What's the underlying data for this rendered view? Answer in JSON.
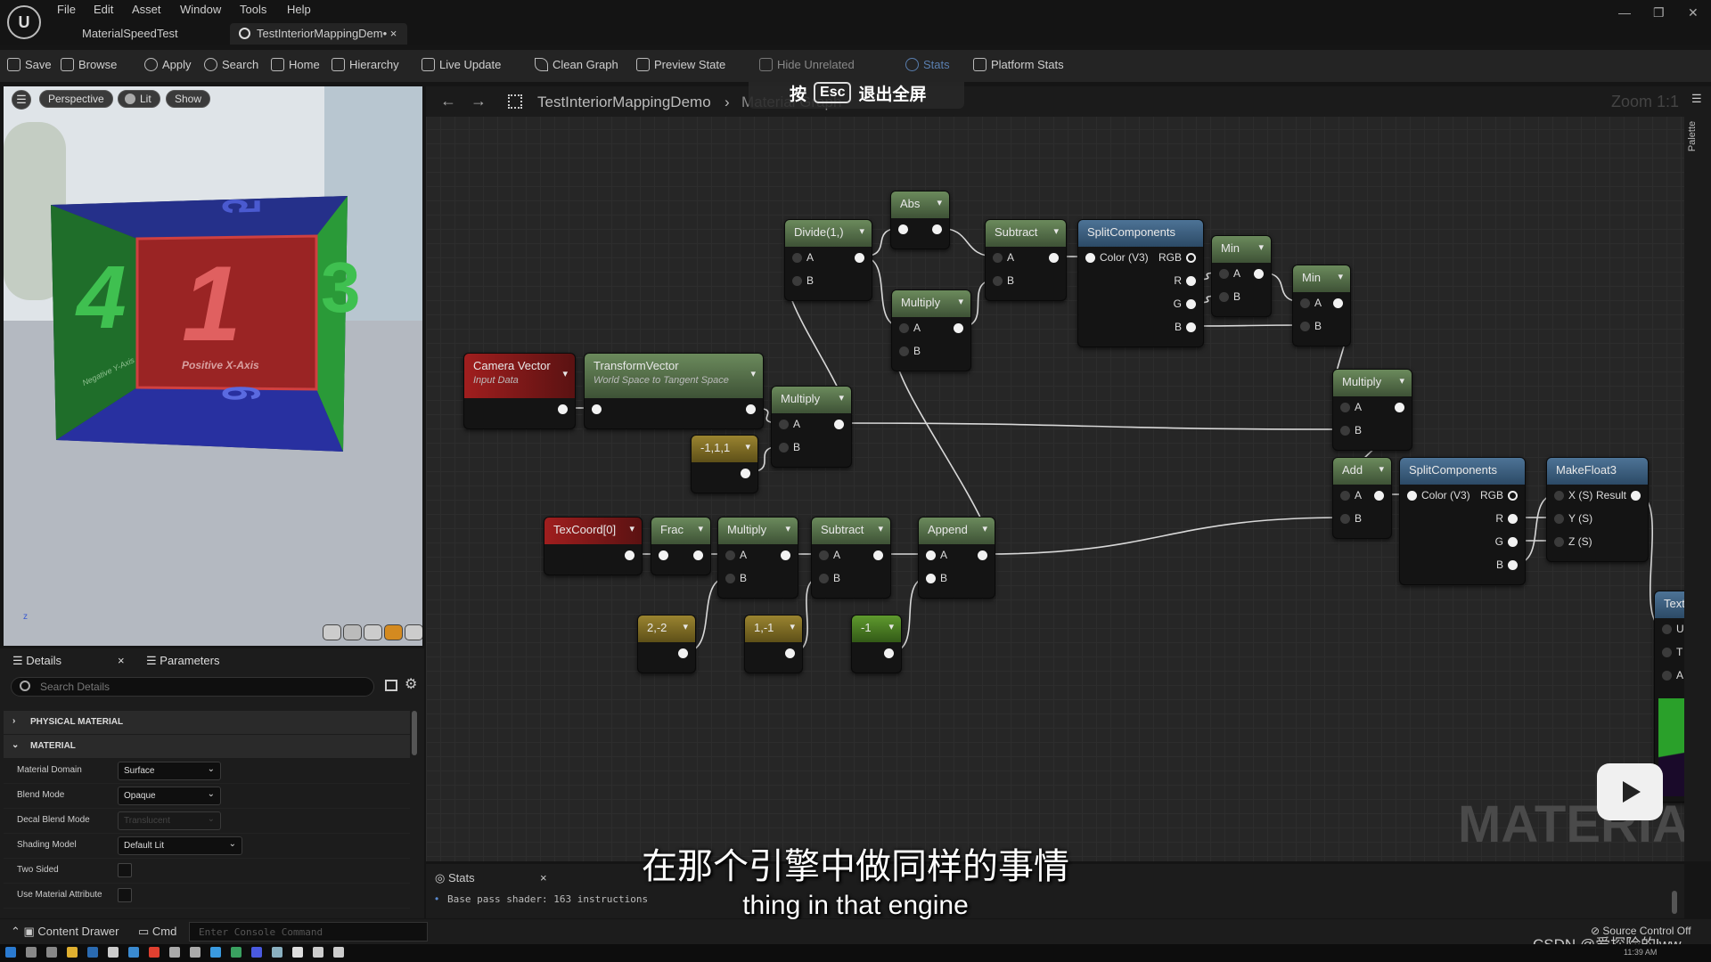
{
  "app": {
    "logo": "U",
    "menu": [
      "File",
      "Edit",
      "Asset",
      "Window",
      "Tools",
      "Help"
    ],
    "tabs": [
      "MaterialSpeedTest",
      "TestInteriorMappingDem• ×"
    ],
    "window_controls": [
      "—",
      "❐",
      "✕"
    ]
  },
  "toolbar": {
    "items": [
      "Save",
      "Browse",
      "Apply",
      "Search",
      "Home",
      "Hierarchy",
      "Live Update",
      "Clean Graph",
      "Preview State",
      "Hide Unrelated",
      "Stats",
      "Platform Stats"
    ]
  },
  "esc_overlay": {
    "prefix": "按",
    "key": "Esc",
    "suffix": "退出全屏"
  },
  "viewport": {
    "buttons": [
      "Perspective",
      "Lit",
      "Show"
    ],
    "cube_labels": {
      "front_number": "1",
      "front_label": "Positive X-Axis",
      "left_number": "4",
      "left_label": "Negative Y-Axis",
      "right_number": "3",
      "top_number": "5",
      "bottom_number": "6"
    },
    "axis": "z"
  },
  "details": {
    "tabs": [
      "Details",
      "Parameters"
    ],
    "close": "×",
    "search_placeholder": "Search Details",
    "sections": [
      "PHYSICAL MATERIAL",
      "MATERIAL"
    ],
    "properties": [
      {
        "label": "Material Domain",
        "type": "select",
        "value": "Surface"
      },
      {
        "label": "Blend Mode",
        "type": "select",
        "value": "Opaque"
      },
      {
        "label": "Decal Blend Mode",
        "type": "select",
        "value": "Translucent",
        "disabled": true
      },
      {
        "label": "Shading Model",
        "type": "select",
        "value": "Default Lit"
      },
      {
        "label": "Two Sided",
        "type": "checkbox",
        "checked": false
      },
      {
        "label": "Use Material Attribute",
        "type": "checkbox",
        "checked": false
      }
    ]
  },
  "graph": {
    "breadcrumb": [
      "TestInteriorMappingDemo",
      "Material Graph"
    ],
    "zoom": "Zoom 1:1",
    "palette_label": "Palette",
    "watermark": "MATERIAL",
    "nodes": [
      {
        "id": "divide",
        "title": "Divide(1,)",
        "kind": "green",
        "inputs": [
          "A",
          "B"
        ],
        "outputs": [
          ""
        ]
      },
      {
        "id": "abs",
        "title": "Abs",
        "kind": "green",
        "inputs": [
          ""
        ],
        "outputs": [
          ""
        ]
      },
      {
        "id": "sub1",
        "title": "Subtract",
        "kind": "green",
        "inputs": [
          "A",
          "B"
        ],
        "outputs": [
          ""
        ]
      },
      {
        "id": "split1",
        "title": "SplitComponents",
        "kind": "blue",
        "inputs": [
          "Color (V3)"
        ],
        "outputs": [
          "RGB",
          "R",
          "G",
          "B"
        ],
        "nochev": true
      },
      {
        "id": "min1",
        "title": "Min",
        "kind": "green",
        "inputs": [
          "A",
          "B"
        ],
        "outputs": [
          ""
        ]
      },
      {
        "id": "min2",
        "title": "Min",
        "kind": "green",
        "inputs": [
          "A",
          "B"
        ],
        "outputs": [
          ""
        ]
      },
      {
        "id": "multmid",
        "title": "Multiply",
        "kind": "green",
        "inputs": [
          "A",
          "B"
        ],
        "outputs": [
          ""
        ]
      },
      {
        "id": "multright",
        "title": "Multiply",
        "kind": "green",
        "inputs": [
          "A",
          "B"
        ],
        "outputs": [
          ""
        ]
      },
      {
        "id": "camera",
        "title": "Camera Vector",
        "subtitle": "Input Data",
        "kind": "red",
        "inputs": [],
        "outputs": [
          ""
        ]
      },
      {
        "id": "transform",
        "title": "TransformVector",
        "subtitle": "World Space to Tangent Space",
        "kind": "green",
        "inputs": [
          ""
        ],
        "outputs": [
          ""
        ]
      },
      {
        "id": "multleft",
        "title": "Multiply",
        "kind": "green",
        "inputs": [
          "A",
          "B"
        ],
        "outputs": [
          ""
        ]
      },
      {
        "id": "c111",
        "title": "-1,1,1",
        "kind": "yellow",
        "inputs": [],
        "outputs": [
          ""
        ]
      },
      {
        "id": "texcoord",
        "title": "TexCoord[0]",
        "kind": "red",
        "inputs": [],
        "outputs": [
          ""
        ]
      },
      {
        "id": "frac",
        "title": "Frac",
        "kind": "green",
        "inputs": [
          ""
        ],
        "outputs": [
          ""
        ]
      },
      {
        "id": "mult2",
        "title": "Multiply",
        "kind": "green",
        "inputs": [
          "A",
          "B"
        ],
        "outputs": [
          ""
        ]
      },
      {
        "id": "sub2",
        "title": "Subtract",
        "kind": "green",
        "inputs": [
          "A",
          "B"
        ],
        "outputs": [
          ""
        ]
      },
      {
        "id": "append",
        "title": "Append",
        "kind": "green",
        "inputs": [
          "A",
          "B"
        ],
        "outputs": [
          ""
        ],
        "filled": true
      },
      {
        "id": "c2m2",
        "title": "2,-2",
        "kind": "yellow",
        "inputs": [],
        "outputs": [
          ""
        ]
      },
      {
        "id": "c1m1",
        "title": "1,-1",
        "kind": "yellow",
        "inputs": [],
        "outputs": [
          ""
        ]
      },
      {
        "id": "cm1",
        "title": "-1",
        "kind": "lime",
        "inputs": [],
        "outputs": [
          ""
        ]
      },
      {
        "id": "add",
        "title": "Add",
        "kind": "green",
        "inputs": [
          "A",
          "B"
        ],
        "outputs": [
          ""
        ]
      },
      {
        "id": "split2",
        "title": "SplitComponents",
        "kind": "blue",
        "inputs": [
          "Color (V3)"
        ],
        "outputs": [
          "RGB",
          "R",
          "G",
          "B"
        ],
        "nochev": true
      },
      {
        "id": "mf3",
        "title": "MakeFloat3",
        "kind": "blue",
        "inputs": [
          "X (S)",
          "Y (S)",
          "Z (S)"
        ],
        "outputs": [
          "Result"
        ],
        "nochev": true
      },
      {
        "id": "texsample",
        "title": "Text",
        "kind": "blue",
        "inputs": [
          "U",
          "T",
          "A"
        ],
        "outputs": [],
        "nochev": true
      }
    ],
    "connections": [
      [
        "divide.0",
        "abs.0"
      ],
      [
        "divide.0",
        "multmid.0"
      ],
      [
        "abs.0",
        "sub1.0"
      ],
      [
        "multmid.0",
        "sub1.1"
      ],
      [
        "sub1.0",
        "split1.0"
      ],
      [
        "split1.1",
        "min1.0"
      ],
      [
        "split1.2",
        "min1.1"
      ],
      [
        "split1.3",
        "min2.1"
      ],
      [
        "min1.0",
        "min2.0"
      ],
      [
        "min2.0",
        "multright.0"
      ],
      [
        "camera.0",
        "transform.0"
      ],
      [
        "transform.0",
        "multleft.0"
      ],
      [
        "c111.0",
        "multleft.1"
      ],
      [
        "multleft.0",
        "multright.1"
      ],
      [
        "multleft.0",
        "divide.1"
      ],
      [
        "append.0",
        "multmid.1"
      ],
      [
        "append.0",
        "add.1"
      ],
      [
        "multright.0",
        "add.0"
      ],
      [
        "add.0",
        "split2.0"
      ],
      [
        "split2.1",
        "mf3.1"
      ],
      [
        "split2.2",
        "mf3.2"
      ],
      [
        "split2.3",
        "mf3.0"
      ],
      [
        "mf3.0",
        "texsample.0"
      ],
      [
        "texcoord.0",
        "frac.0"
      ],
      [
        "frac.0",
        "mult2.0"
      ],
      [
        "mult2.0",
        "sub2.0"
      ],
      [
        "sub2.0",
        "append.0"
      ],
      [
        "c2m2.0",
        "mult2.1"
      ],
      [
        "c1m1.0",
        "sub2.1"
      ],
      [
        "cm1.0",
        "append.1"
      ]
    ]
  },
  "stats": {
    "tab": "Stats",
    "close": "×",
    "lines": [
      "Base pass shader: 163 instructions"
    ]
  },
  "bottombar": {
    "content_drawer": "Content Drawer",
    "cmd": "Cmd",
    "console_placeholder": "Enter Console Command",
    "source_control": "Source Control Off"
  },
  "subtitles": {
    "zh": "在那个引擎中做同样的事情",
    "en": "thing in that engine"
  },
  "watermark": "CSDN @爱探险的lww",
  "taskbar": {
    "time": "11:39 AM"
  },
  "colors": {
    "node_green": "#5d7a4e",
    "node_red": "#a01e1e",
    "node_blue": "#4d7396",
    "node_const": "#9a8430",
    "graph_bg": "#262626"
  }
}
